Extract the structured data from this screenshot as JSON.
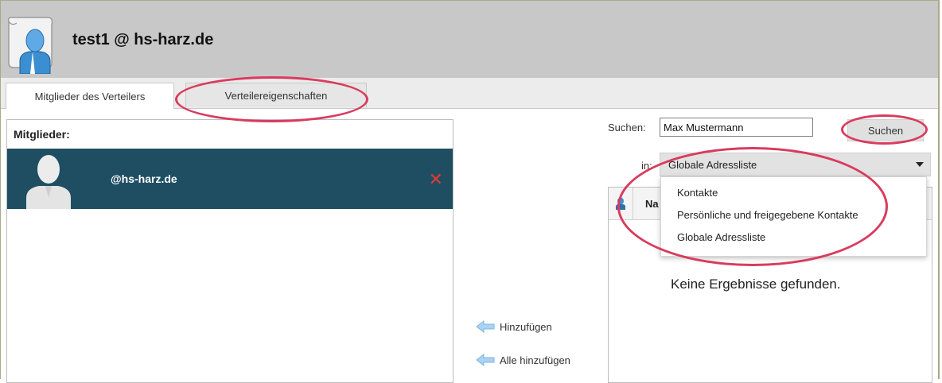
{
  "header": {
    "title": "test1 @ hs-harz.de",
    "icon": "user-card-icon"
  },
  "tabs": [
    {
      "label": "Mitglieder des Verteilers",
      "active": true
    },
    {
      "label": "Verteilereigenschaften",
      "active": false
    }
  ],
  "members": {
    "title": "Mitglieder:",
    "items": [
      {
        "email": "@hs-harz.de",
        "avatar": "user-avatar-icon",
        "remove_icon": "close-icon"
      }
    ]
  },
  "actions": {
    "add_label": "Hinzufügen",
    "add_all_label": "Alle hinzufügen",
    "icon": "arrow-left-icon"
  },
  "search": {
    "label": "Suchen:",
    "value": "Max Mustermann",
    "button_label": "Suchen",
    "in_label": "in:",
    "selected": "Globale Adressliste",
    "options": [
      "Kontakte",
      "Persönliche und freigegebene Kontakte",
      "Globale Adressliste"
    ]
  },
  "results": {
    "header_label": "Na",
    "empty_text": "Keine Ergebnisse gefunden."
  },
  "colors": {
    "member_row_bg": "#1f4e63",
    "highlight_ellipse": "#d93b5e",
    "remove_icon": "#e23b35"
  }
}
